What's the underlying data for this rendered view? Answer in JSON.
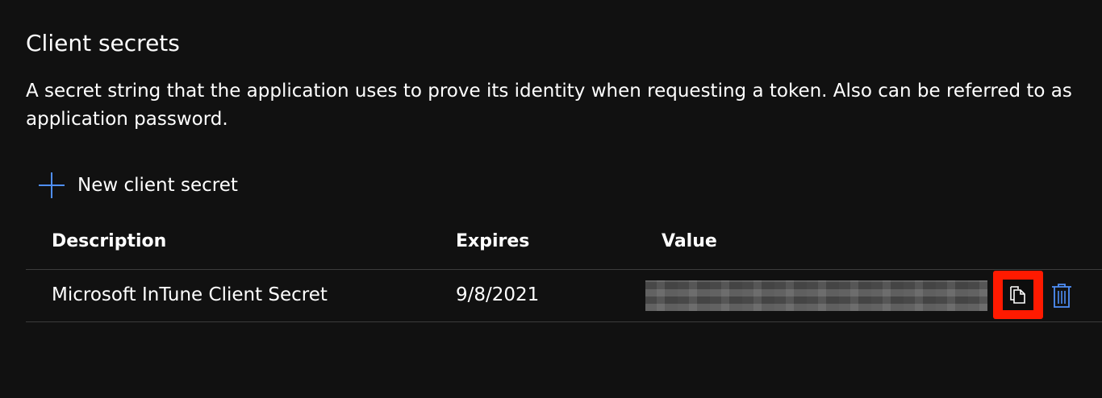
{
  "section": {
    "title": "Client secrets",
    "description": "A secret string that the application uses to prove its identity when requesting a token. Also can be referred to as application password."
  },
  "toolbar": {
    "new_secret_label": "New client secret",
    "new_secret_icon": "plus-icon"
  },
  "table": {
    "columns": [
      "Description",
      "Expires",
      "Value"
    ],
    "rows": [
      {
        "description": "Microsoft InTune Client Secret",
        "expires": "9/8/2021",
        "value_masked": true,
        "actions": [
          "copy-icon",
          "delete-icon"
        ]
      }
    ]
  },
  "colors": {
    "background": "#111111",
    "text": "#ffffff",
    "accent": "#4f8ff7",
    "highlight": "#ff1a00",
    "divider": "#3c3c3c"
  }
}
